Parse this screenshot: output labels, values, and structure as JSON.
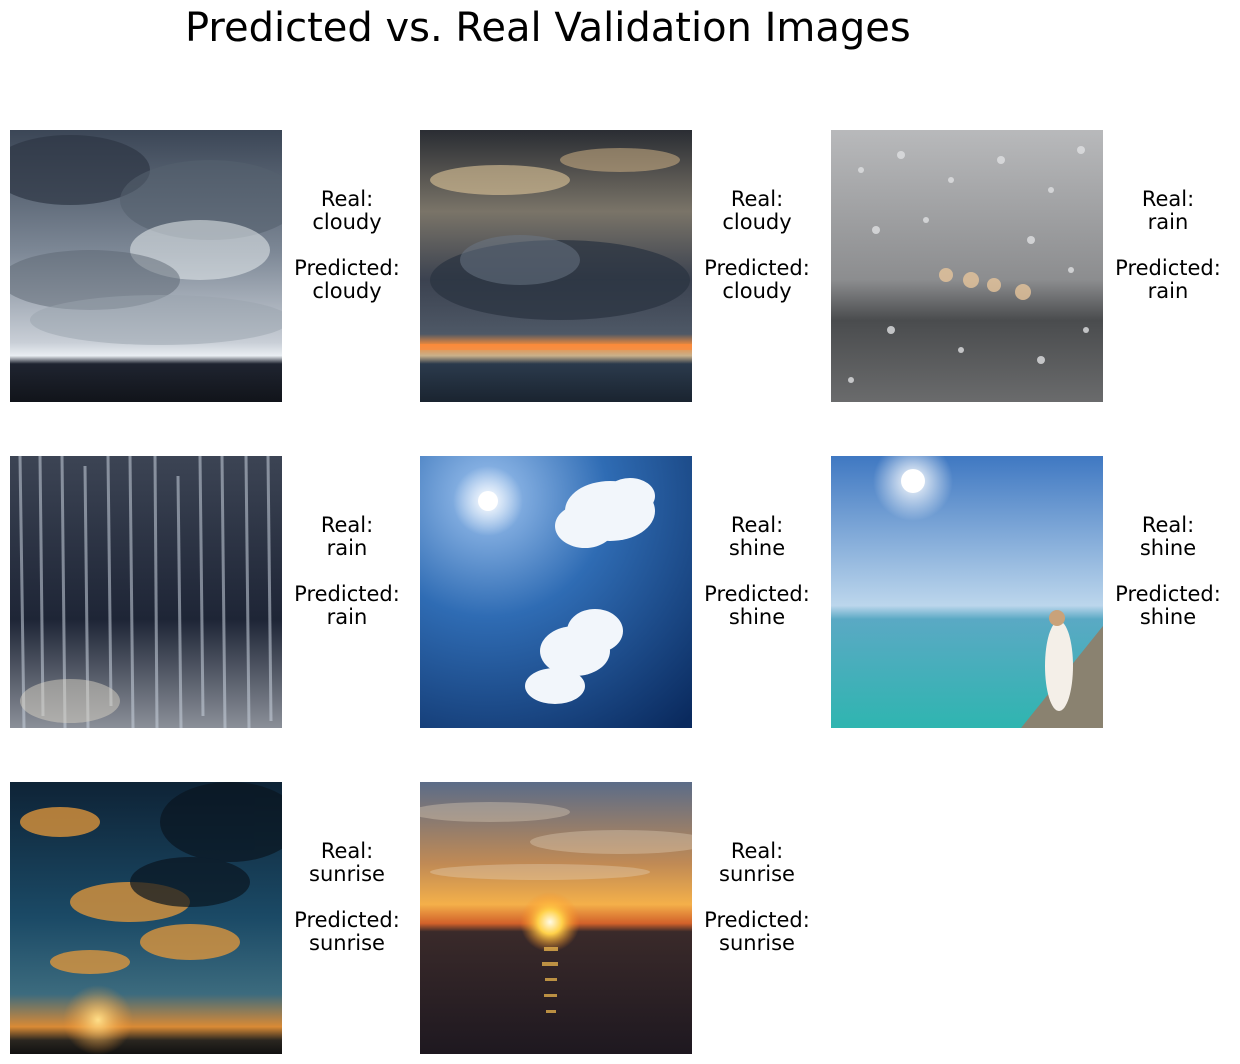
{
  "figure": {
    "title": "Predicted vs. Real Validation Images",
    "real_prefix": "Real:",
    "predicted_prefix": "Predicted:"
  },
  "samples": [
    {
      "real": "cloudy",
      "predicted": "cloudy",
      "scene": "stormy-clouds-over-sea"
    },
    {
      "real": "cloudy",
      "predicted": "cloudy",
      "scene": "dark-clouds-orange-horizon-sea"
    },
    {
      "real": "rain",
      "predicted": "rain",
      "scene": "raindrops-on-window"
    },
    {
      "real": "rain",
      "predicted": "rain",
      "scene": "heavy-rain-streaks"
    },
    {
      "real": "shine",
      "predicted": "shine",
      "scene": "sun-blue-sky-clouds"
    },
    {
      "real": "shine",
      "predicted": "shine",
      "scene": "sunny-sea-coast-bride"
    },
    {
      "real": "sunrise",
      "predicted": "sunrise",
      "scene": "sunrise-clouds-dark-sky"
    },
    {
      "real": "sunrise",
      "predicted": "sunrise",
      "scene": "sunset-over-sea"
    }
  ]
}
